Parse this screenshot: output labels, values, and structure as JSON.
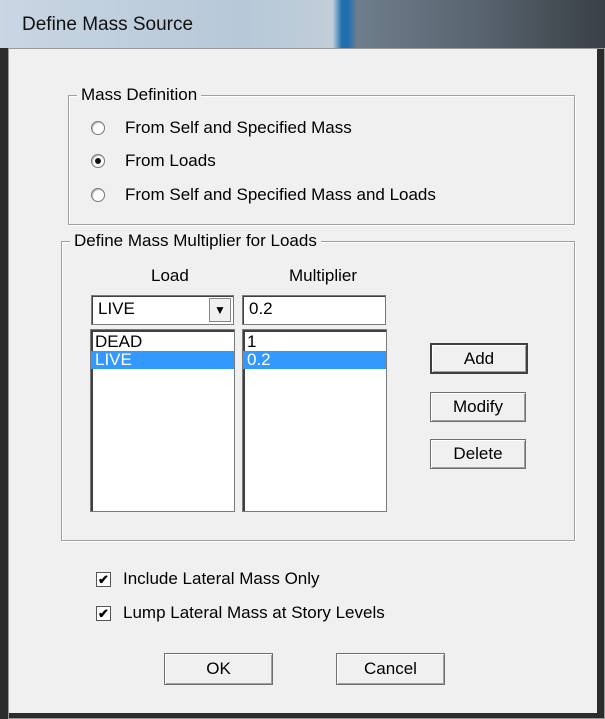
{
  "window": {
    "title": "Define Mass Source"
  },
  "mass_definition": {
    "legend": "Mass Definition",
    "options": [
      {
        "label": "From Self and Specified Mass",
        "selected": false
      },
      {
        "label": "From Loads",
        "selected": true
      },
      {
        "label": "From Self and Specified Mass and Loads",
        "selected": false
      }
    ]
  },
  "multiplier_group": {
    "legend": "Define Mass Multiplier for Loads",
    "load_header": "Load",
    "multiplier_header": "Multiplier",
    "load_combo_value": "LIVE",
    "multiplier_input_value": "0.2",
    "rows": [
      {
        "load": "DEAD",
        "multiplier": "1",
        "selected": false
      },
      {
        "load": "LIVE",
        "multiplier": "0.2",
        "selected": true
      }
    ],
    "add_label": "Add",
    "modify_label": "Modify",
    "delete_label": "Delete"
  },
  "options": {
    "include_lateral_label": "Include Lateral Mass Only",
    "include_lateral_checked": true,
    "lump_lateral_label": "Lump Lateral Mass at Story Levels",
    "lump_lateral_checked": true
  },
  "footer": {
    "ok_label": "OK",
    "cancel_label": "Cancel"
  },
  "icons": {
    "checkmark": "✔",
    "dropdown_arrow": "▼"
  }
}
